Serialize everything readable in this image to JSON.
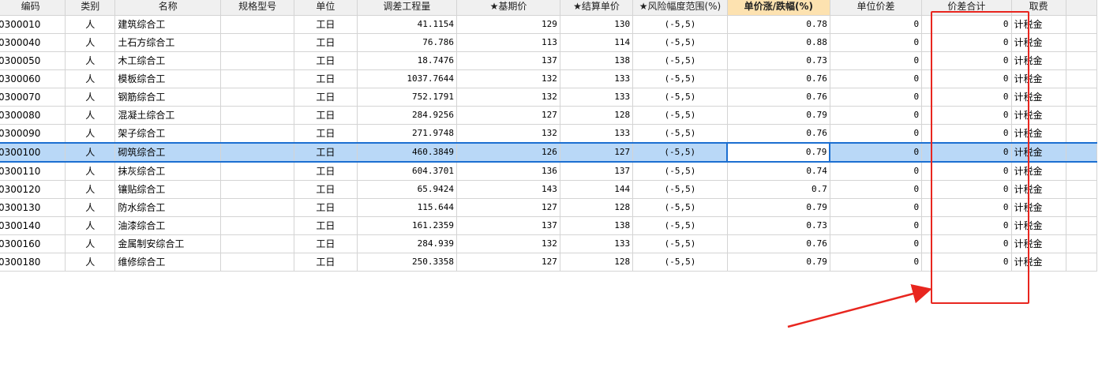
{
  "columns": [
    "编码",
    "类别",
    "名称",
    "规格型号",
    "单位",
    "调差工程量",
    "★基期价",
    "★结算单价",
    "★风险幅度范围(%)",
    "单价涨/跌幅(%)",
    "单位价差",
    "价差合计",
    "取费",
    ""
  ],
  "rows": [
    {
      "code": "0300010",
      "type": "人",
      "name": "建筑综合工",
      "spec": "",
      "unit": "工日",
      "qty": "41.1154",
      "base": "129",
      "settle": "130",
      "risk": "(-5,5)",
      "rate": "0.78",
      "unit_diff": "0",
      "total_diff": "0",
      "fee": "计税金"
    },
    {
      "code": "0300040",
      "type": "人",
      "name": "土石方综合工",
      "spec": "",
      "unit": "工日",
      "qty": "76.786",
      "base": "113",
      "settle": "114",
      "risk": "(-5,5)",
      "rate": "0.88",
      "unit_diff": "0",
      "total_diff": "0",
      "fee": "计税金"
    },
    {
      "code": "0300050",
      "type": "人",
      "name": "木工综合工",
      "spec": "",
      "unit": "工日",
      "qty": "18.7476",
      "base": "137",
      "settle": "138",
      "risk": "(-5,5)",
      "rate": "0.73",
      "unit_diff": "0",
      "total_diff": "0",
      "fee": "计税金"
    },
    {
      "code": "0300060",
      "type": "人",
      "name": "模板综合工",
      "spec": "",
      "unit": "工日",
      "qty": "1037.7644",
      "base": "132",
      "settle": "133",
      "risk": "(-5,5)",
      "rate": "0.76",
      "unit_diff": "0",
      "total_diff": "0",
      "fee": "计税金"
    },
    {
      "code": "0300070",
      "type": "人",
      "name": "钢筋综合工",
      "spec": "",
      "unit": "工日",
      "qty": "752.1791",
      "base": "132",
      "settle": "133",
      "risk": "(-5,5)",
      "rate": "0.76",
      "unit_diff": "0",
      "total_diff": "0",
      "fee": "计税金"
    },
    {
      "code": "0300080",
      "type": "人",
      "name": "混凝土综合工",
      "spec": "",
      "unit": "工日",
      "qty": "284.9256",
      "base": "127",
      "settle": "128",
      "risk": "(-5,5)",
      "rate": "0.79",
      "unit_diff": "0",
      "total_diff": "0",
      "fee": "计税金"
    },
    {
      "code": "0300090",
      "type": "人",
      "name": "架子综合工",
      "spec": "",
      "unit": "工日",
      "qty": "271.9748",
      "base": "132",
      "settle": "133",
      "risk": "(-5,5)",
      "rate": "0.76",
      "unit_diff": "0",
      "total_diff": "0",
      "fee": "计税金"
    },
    {
      "code": "0300100",
      "type": "人",
      "name": "砌筑综合工",
      "spec": "",
      "unit": "工日",
      "qty": "460.3849",
      "base": "126",
      "settle": "127",
      "risk": "(-5,5)",
      "rate": "0.79",
      "unit_diff": "0",
      "total_diff": "0",
      "fee": "计税金"
    },
    {
      "code": "0300110",
      "type": "人",
      "name": "抹灰综合工",
      "spec": "",
      "unit": "工日",
      "qty": "604.3701",
      "base": "136",
      "settle": "137",
      "risk": "(-5,5)",
      "rate": "0.74",
      "unit_diff": "0",
      "total_diff": "0",
      "fee": "计税金"
    },
    {
      "code": "0300120",
      "type": "人",
      "name": "镶贴综合工",
      "spec": "",
      "unit": "工日",
      "qty": "65.9424",
      "base": "143",
      "settle": "144",
      "risk": "(-5,5)",
      "rate": "0.7",
      "unit_diff": "0",
      "total_diff": "0",
      "fee": "计税金"
    },
    {
      "code": "0300130",
      "type": "人",
      "name": "防水综合工",
      "spec": "",
      "unit": "工日",
      "qty": "115.644",
      "base": "127",
      "settle": "128",
      "risk": "(-5,5)",
      "rate": "0.79",
      "unit_diff": "0",
      "total_diff": "0",
      "fee": "计税金"
    },
    {
      "code": "0300140",
      "type": "人",
      "name": "油漆综合工",
      "spec": "",
      "unit": "工日",
      "qty": "161.2359",
      "base": "137",
      "settle": "138",
      "risk": "(-5,5)",
      "rate": "0.73",
      "unit_diff": "0",
      "total_diff": "0",
      "fee": "计税金"
    },
    {
      "code": "0300160",
      "type": "人",
      "name": "金属制安综合工",
      "spec": "",
      "unit": "工日",
      "qty": "284.939",
      "base": "132",
      "settle": "133",
      "risk": "(-5,5)",
      "rate": "0.76",
      "unit_diff": "0",
      "total_diff": "0",
      "fee": "计税金"
    },
    {
      "code": "0300180",
      "type": "人",
      "name": "维修综合工",
      "spec": "",
      "unit": "工日",
      "qty": "250.3358",
      "base": "127",
      "settle": "128",
      "risk": "(-5,5)",
      "rate": "0.79",
      "unit_diff": "0",
      "total_diff": "0",
      "fee": "计税金"
    }
  ],
  "selected_row": 7,
  "active_column": 9,
  "annotation": {
    "color": "#e8261f"
  }
}
